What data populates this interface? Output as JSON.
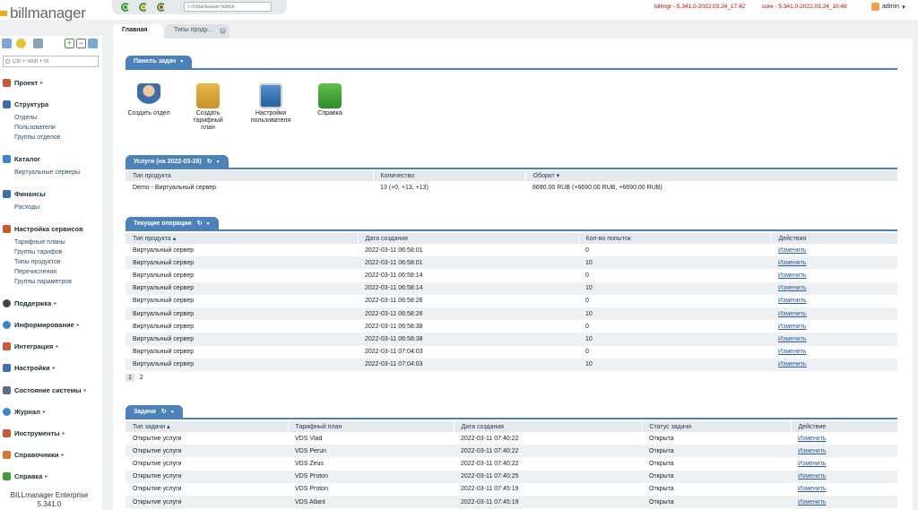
{
  "app": {
    "logo": "billmanager",
    "global_search_placeholder": "Глобальный поиск",
    "version_billmgr": "billmgr - 5.341.0-2022.03.24_17:42",
    "version_core": "core - 5.341.0-2022.03.24_10:48",
    "user": "admin",
    "footer_name": "BILLmanager Enterprise",
    "footer_version": "5.341.0"
  },
  "colors": {
    "accent": "#4d82b8",
    "link": "#2a5aa0",
    "version": "#cc0000"
  },
  "sidebar": {
    "search_placeholder": "Ctrl + Shift + M",
    "sections": [
      {
        "label": "Проект",
        "icon": "project-icon",
        "items": []
      },
      {
        "label": "Структура",
        "icon": "structure-icon",
        "items": [
          "Отделы",
          "Пользователи",
          "Группы отделов"
        ]
      },
      {
        "label": "Каталог",
        "icon": "catalog-icon",
        "items": [
          "Виртуальные серверы"
        ]
      },
      {
        "label": "Финансы",
        "icon": "finance-icon",
        "items": [
          "Расходы"
        ]
      },
      {
        "label": "Настройка сервисов",
        "icon": "service-settings-icon",
        "items": [
          "Тарифные планы",
          "Группы тарифов",
          "Типы продуктов",
          "Перечисления",
          "Группы параметров"
        ]
      },
      {
        "label": "Поддержка",
        "icon": "support-icon",
        "items": []
      },
      {
        "label": "Информирование",
        "icon": "notification-icon",
        "items": []
      },
      {
        "label": "Интеграция",
        "icon": "integration-icon",
        "items": []
      },
      {
        "label": "Настройки",
        "icon": "settings-icon",
        "items": []
      },
      {
        "label": "Состояние системы",
        "icon": "system-state-icon",
        "items": []
      },
      {
        "label": "Журнал",
        "icon": "journal-icon",
        "items": []
      },
      {
        "label": "Инструменты",
        "icon": "tools-icon",
        "items": []
      },
      {
        "label": "Справочники",
        "icon": "references-icon",
        "items": []
      },
      {
        "label": "Справка",
        "icon": "help-icon",
        "items": []
      }
    ]
  },
  "tabs": [
    {
      "label": "Главная",
      "active": true
    },
    {
      "label": "Типы проду...",
      "active": false
    }
  ],
  "task_panel": {
    "title": "Панель задач",
    "items": [
      {
        "label": "Создать отдел",
        "icon": "user-icon"
      },
      {
        "label": "Создать тарифный план",
        "icon": "tariff-plan-icon"
      },
      {
        "label": "Настройки пользователя",
        "icon": "user-settings-icon"
      },
      {
        "label": "Справка",
        "icon": "help-book-icon"
      }
    ]
  },
  "services": {
    "title": "Услуги (на 2022-03-28)",
    "columns": [
      "Тип продукта",
      "Количество",
      "Оборот"
    ],
    "rows": [
      [
        "Demo - Виртуальный сервер",
        "13 (+0, +13, +13)",
        "6690.00 RUB (+6690.00 RUB, +6690.00 RUB)"
      ]
    ]
  },
  "operations": {
    "title": "Текущие операции",
    "columns": [
      "Тип продукта",
      "Дата создания",
      "Кол-во попыток",
      "Действия"
    ],
    "rows": [
      [
        "Виртуальный сервер",
        "2022-03-11 06:58:01",
        "0",
        "Изменить"
      ],
      [
        "Виртуальный сервер",
        "2022-03-11 06:58:01",
        "10",
        "Изменить"
      ],
      [
        "Виртуальный сервер",
        "2022-03-11 06:58:14",
        "0",
        "Изменить"
      ],
      [
        "Виртуальный сервер",
        "2022-03-11 06:58:14",
        "10",
        "Изменить"
      ],
      [
        "Виртуальный сервер",
        "2022-03-11 06:58:26",
        "0",
        "Изменить"
      ],
      [
        "Виртуальный сервер",
        "2022-03-11 06:58:26",
        "10",
        "Изменить"
      ],
      [
        "Виртуальный сервер",
        "2022-03-11 06:58:38",
        "0",
        "Изменить"
      ],
      [
        "Виртуальный сервер",
        "2022-03-11 06:58:38",
        "10",
        "Изменить"
      ],
      [
        "Виртуальный сервер",
        "2022-03-11 07:04:03",
        "0",
        "Изменить"
      ],
      [
        "Виртуальный сервер",
        "2022-03-11 07:04:03",
        "10",
        "Изменить"
      ]
    ],
    "pages": [
      "1",
      "2"
    ]
  },
  "tasks": {
    "title": "Задачи",
    "columns": [
      "Тип задачи",
      "Тарифный план",
      "Дата создания",
      "Статус задачи",
      "Действие"
    ],
    "rows": [
      [
        "Открытие услуги",
        "VDS Vlad",
        "2022-03-11 07:40:22",
        "Открыта",
        "Изменить"
      ],
      [
        "Открытие услуги",
        "VDS Perun",
        "2022-03-11 07:40:22",
        "Открыта",
        "Изменить"
      ],
      [
        "Открытие услуги",
        "VDS Zeus",
        "2022-03-11 07:40:22",
        "Открыта",
        "Изменить"
      ],
      [
        "Открытие услуги",
        "VDS Proton",
        "2022-03-11 07:40:25",
        "Открыта",
        "Изменить"
      ],
      [
        "Открытие услуги",
        "VDS Proton",
        "2022-03-11 07:45:19",
        "Открыта",
        "Изменить"
      ],
      [
        "Открытие услуги",
        "VDS Atlant",
        "2022-03-11 07:45:19",
        "Открыта",
        "Изменить"
      ]
    ]
  }
}
